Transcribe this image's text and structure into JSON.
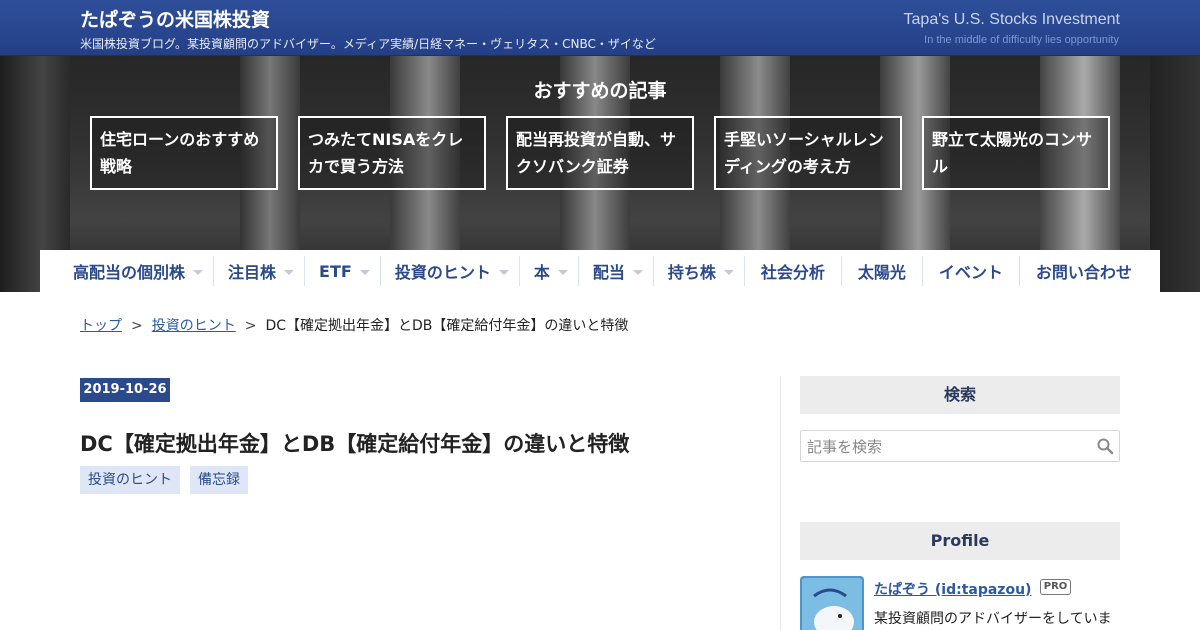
{
  "header": {
    "title": "たぱぞうの米国株投資",
    "description": "米国株投資ブログ。某投資顧問のアドバイザー。メディア実績/日経マネー・ヴェリタス・CNBC・ザイなど",
    "en_title": "Tapa's U.S. Stocks Investment",
    "en_subtitle": "In the middle of difficulty lies opportunity"
  },
  "hero": {
    "title": "おすすめの記事",
    "cards": [
      {
        "label": "住宅ローンのおすすめ戦略"
      },
      {
        "label": "つみたてNISAをクレカで買う方法"
      },
      {
        "label": "配当再投資が自動、サクソバンク証券"
      },
      {
        "label": "手堅いソーシャルレンディングの考え方"
      },
      {
        "label": "野立て太陽光のコンサル"
      }
    ]
  },
  "nav": {
    "items": [
      {
        "label": "高配当の個別株",
        "has_dropdown": true
      },
      {
        "label": "注目株",
        "has_dropdown": true
      },
      {
        "label": "ETF",
        "has_dropdown": true
      },
      {
        "label": "投資のヒント",
        "has_dropdown": true
      },
      {
        "label": "本",
        "has_dropdown": true
      },
      {
        "label": "配当",
        "has_dropdown": true
      },
      {
        "label": "持ち株",
        "has_dropdown": true
      },
      {
        "label": "社会分析",
        "has_dropdown": false
      },
      {
        "label": "太陽光",
        "has_dropdown": false
      },
      {
        "label": "イベント",
        "has_dropdown": false
      },
      {
        "label": "お問い合わせ",
        "has_dropdown": false
      }
    ]
  },
  "breadcrumb": {
    "top": "トップ",
    "category": "投資のヒント",
    "separator": ">",
    "current": "DC【確定拠出年金】とDB【確定給付年金】の違いと特徴"
  },
  "article": {
    "date": "2019-10-26",
    "title": "DC【確定拠出年金】とDB【確定給付年金】の違いと特徴",
    "categories": [
      "投資のヒント",
      "備忘録"
    ]
  },
  "sidebar": {
    "search_heading": "検索",
    "search_placeholder": "記事を検索",
    "profile_heading": "Profile",
    "profile_name": "たぱぞう (id:tapazou)",
    "pro_badge": "PRO",
    "profile_desc": "某投資顧問のアドバイザーをしていま"
  },
  "colors": {
    "header_blue": "#2b4a8b",
    "link_blue": "#2b5aa0",
    "tag_bg": "#dfe7f6",
    "sidebar_head_bg": "#ececec"
  },
  "icons": {
    "search": "search-icon",
    "dropdown": "chevron-down-icon"
  }
}
